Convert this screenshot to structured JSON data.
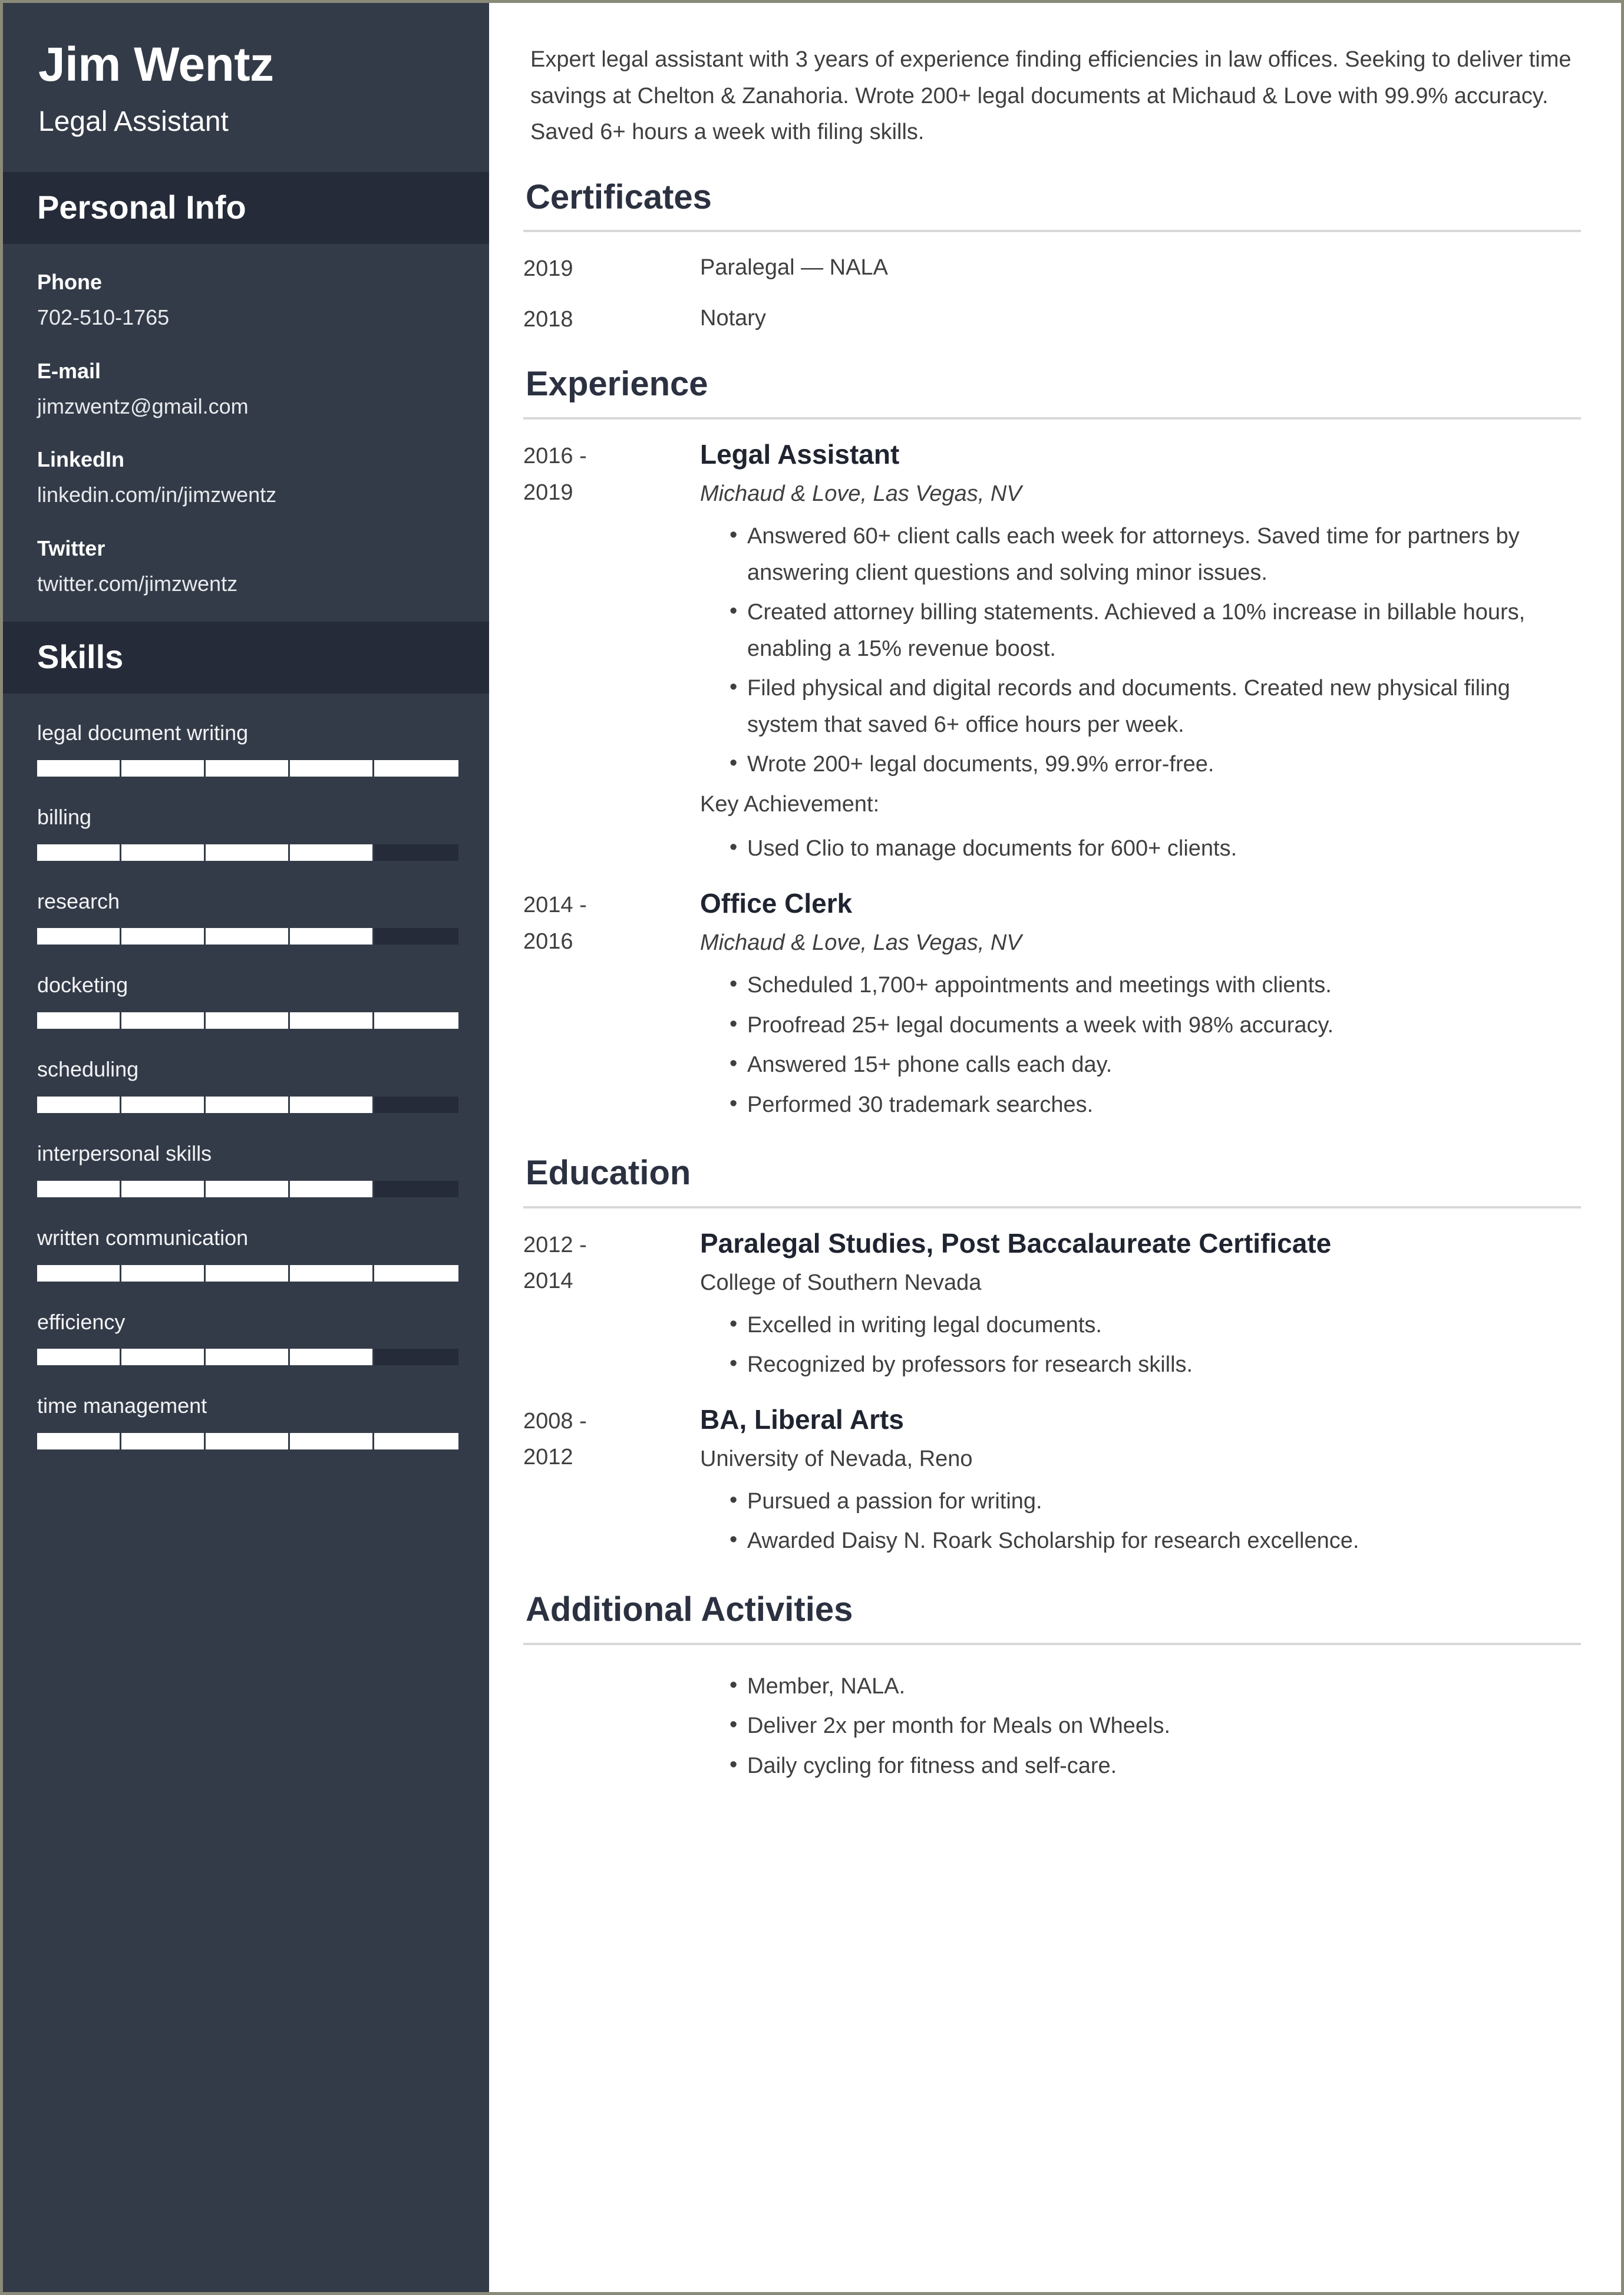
{
  "colors": {
    "sidebar_bg": "#343b48",
    "sidebar_header_bg": "#252b38",
    "skill_fill": "#ffffff",
    "skill_track": "#252b38",
    "text_dark": "#3f3f3f",
    "heading": "#2b3140",
    "page_border": "#8a8a78"
  },
  "sidebar": {
    "name": "Jim Wentz",
    "role": "Legal Assistant",
    "personal_info": {
      "title": "Personal Info",
      "items": [
        {
          "label": "Phone",
          "value": "702-510-1765"
        },
        {
          "label": "E-mail",
          "value": "jimzwentz@gmail.com"
        },
        {
          "label": "LinkedIn",
          "value": "linkedin.com/in/jimzwentz"
        },
        {
          "label": "Twitter",
          "value": "twitter.com/jimzwentz"
        }
      ]
    },
    "skills": {
      "title": "Skills",
      "items": [
        {
          "label": "legal document writing",
          "level": 100
        },
        {
          "label": "billing",
          "level": 80
        },
        {
          "label": "research",
          "level": 80
        },
        {
          "label": "docketing",
          "level": 100
        },
        {
          "label": "scheduling",
          "level": 80
        },
        {
          "label": "interpersonal skills",
          "level": 80
        },
        {
          "label": "written communication",
          "level": 100
        },
        {
          "label": "efficiency",
          "level": 80
        },
        {
          "label": "time management",
          "level": 100
        }
      ]
    }
  },
  "main": {
    "summary": "Expert legal assistant with 3 years of experience finding efficiencies in law offices. Seeking to deliver time savings at Chelton & Zanahoria. Wrote 200+ legal documents at Michaud & Love with 99.9% accuracy. Saved 6+ hours a week with filing skills.",
    "certificates": {
      "title": "Certificates",
      "items": [
        {
          "year": "2019",
          "name": "Paralegal — NALA"
        },
        {
          "year": "2018",
          "name": "Notary"
        }
      ]
    },
    "experience": {
      "title": "Experience",
      "entries": [
        {
          "date_start": "2016 -",
          "date_end": "2019",
          "title": "Legal Assistant",
          "meta": "Michaud & Love, Las Vegas, NV",
          "bullets": [
            "Answered 60+ client calls each week for attorneys. Saved time for partners by answering client questions and solving minor issues.",
            "Created attorney billing statements. Achieved a 10% increase in billable hours, enabling a 15% revenue boost.",
            "Filed physical and digital records and documents. Created new physical filing system that saved 6+ office hours per week.",
            "Wrote 200+ legal documents, 99.9% error-free."
          ],
          "key_achievement_label": "Key Achievement:",
          "key_achievement_bullets": [
            "Used Clio to manage documents for 600+ clients."
          ]
        },
        {
          "date_start": "2014 -",
          "date_end": "2016",
          "title": "Office Clerk",
          "meta": "Michaud & Love, Las Vegas, NV",
          "bullets": [
            "Scheduled 1,700+ appointments and meetings with clients.",
            "Proofread 25+ legal documents a week with 98% accuracy.",
            "Answered 15+ phone calls each day.",
            "Performed 30 trademark searches."
          ],
          "key_achievement_label": "",
          "key_achievement_bullets": []
        }
      ]
    },
    "education": {
      "title": "Education",
      "entries": [
        {
          "date_start": "2012 -",
          "date_end": "2014",
          "title": "Paralegal Studies, Post Baccalaureate Certificate",
          "meta": "College of Southern Nevada",
          "bullets": [
            "Excelled in writing legal documents.",
            "Recognized by professors for research skills."
          ]
        },
        {
          "date_start": "2008 -",
          "date_end": "2012",
          "title": "BA, Liberal Arts",
          "meta": "University of Nevada, Reno",
          "bullets": [
            "Pursued a passion for writing.",
            "Awarded Daisy N. Roark Scholarship for research excellence."
          ]
        }
      ]
    },
    "additional_activities": {
      "title": "Additional Activities",
      "bullets": [
        "Member, NALA.",
        "Deliver 2x per month for Meals on Wheels.",
        "Daily cycling for fitness and self-care."
      ]
    }
  }
}
